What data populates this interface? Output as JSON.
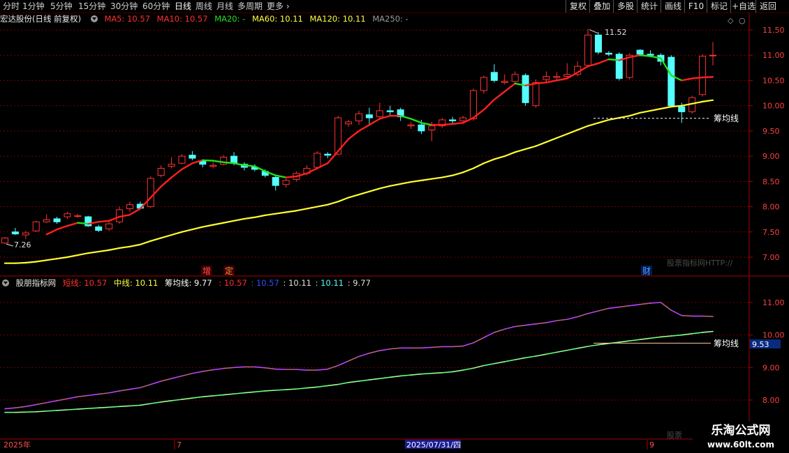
{
  "toolbar": {
    "periods": [
      "分时",
      "1分钟",
      "5分钟",
      "15分钟",
      "30分钟",
      "60分钟",
      "日线",
      "周线",
      "月线",
      "多周期",
      "更多"
    ],
    "active_period": "日线",
    "tools": [
      "复权",
      "叠加",
      "多股",
      "统计",
      "画线",
      "F10",
      "标记",
      "+自选",
      "返回"
    ]
  },
  "main_header": {
    "stock": "宏达股份(日线 前复权)",
    "ma5": "MA5: 10.57",
    "ma10": "MA10: 10.57",
    "ma20": "MA20: -",
    "ma60": "MA60: 10.11",
    "ma120": "MA120: 10.11",
    "ma250": "MA250: -"
  },
  "sub_header": {
    "name": "股朋指标网",
    "short": "短线: 10.57",
    "mid": "中线: 10.11",
    "chip": "筹均线: 9.77",
    "v1": ": 10.57",
    "v2": ": 10.57",
    "v3": ": 10.11",
    "v4": ": 10.11",
    "v5": ": 9.77"
  },
  "annotations": {
    "high_label": "11.52",
    "low_label": "7.26",
    "chip_label_main": "筹均线",
    "chip_label_sub": "筹均线",
    "chip_value_tag": "9.53",
    "event_zeng": "增",
    "event_ding": "定",
    "event_cai": "财",
    "watermark_main": "股票指标网HTTP://",
    "watermark_sub": "股票"
  },
  "time_axis": {
    "labels": [
      "2025年",
      "7",
      "2025/07/31/四",
      "9"
    ]
  },
  "price_axis": {
    "ticks": [
      "11.50",
      "11.00",
      "10.50",
      "10.00",
      "9.50",
      "9.00",
      "8.50",
      "8.00",
      "7.50",
      "7.00"
    ]
  },
  "indicator_axis": {
    "ticks": [
      "11.00",
      "10.00",
      "9.00",
      "8.00"
    ]
  },
  "site_watermark": {
    "name": "乐淘公式网",
    "url": "www.60lt.com"
  },
  "colors": {
    "up": "#ff3232",
    "down": "#54ffff",
    "ma5": "#ff2020",
    "ma20": "#20e020",
    "ma60": "#ffff30",
    "grid": "#780000"
  },
  "chart_data": {
    "type": "candlestick",
    "ylim": [
      6.8,
      11.75
    ],
    "candles": [
      {
        "o": 7.28,
        "h": 7.4,
        "l": 7.26,
        "c": 7.38
      },
      {
        "o": 7.5,
        "h": 7.58,
        "l": 7.44,
        "c": 7.46
      },
      {
        "o": 7.44,
        "h": 7.52,
        "l": 7.36,
        "c": 7.48
      },
      {
        "o": 7.52,
        "h": 7.72,
        "l": 7.5,
        "c": 7.7
      },
      {
        "o": 7.7,
        "h": 7.85,
        "l": 7.68,
        "c": 7.74
      },
      {
        "o": 7.76,
        "h": 7.8,
        "l": 7.66,
        "c": 7.7
      },
      {
        "o": 7.8,
        "h": 7.9,
        "l": 7.76,
        "c": 7.86
      },
      {
        "o": 7.82,
        "h": 7.86,
        "l": 7.78,
        "c": 7.82
      },
      {
        "o": 7.8,
        "h": 7.82,
        "l": 7.6,
        "c": 7.62
      },
      {
        "o": 7.6,
        "h": 7.64,
        "l": 7.5,
        "c": 7.53
      },
      {
        "o": 7.56,
        "h": 7.7,
        "l": 7.52,
        "c": 7.66
      },
      {
        "o": 7.7,
        "h": 8.0,
        "l": 7.66,
        "c": 7.94
      },
      {
        "o": 7.96,
        "h": 8.1,
        "l": 7.9,
        "c": 8.04
      },
      {
        "o": 8.05,
        "h": 8.1,
        "l": 7.96,
        "c": 7.97
      },
      {
        "o": 8.0,
        "h": 8.6,
        "l": 7.98,
        "c": 8.56
      },
      {
        "o": 8.62,
        "h": 8.82,
        "l": 8.58,
        "c": 8.76
      },
      {
        "o": 8.8,
        "h": 8.98,
        "l": 8.76,
        "c": 8.84
      },
      {
        "o": 8.86,
        "h": 9.04,
        "l": 8.84,
        "c": 9.0
      },
      {
        "o": 9.02,
        "h": 9.1,
        "l": 8.92,
        "c": 8.96
      },
      {
        "o": 8.9,
        "h": 8.94,
        "l": 8.78,
        "c": 8.84
      },
      {
        "o": 8.8,
        "h": 8.88,
        "l": 8.76,
        "c": 8.82
      },
      {
        "o": 8.84,
        "h": 9.02,
        "l": 8.82,
        "c": 8.98
      },
      {
        "o": 9.0,
        "h": 9.08,
        "l": 8.82,
        "c": 8.86
      },
      {
        "o": 8.84,
        "h": 8.88,
        "l": 8.72,
        "c": 8.78
      },
      {
        "o": 8.78,
        "h": 8.84,
        "l": 8.7,
        "c": 8.74
      },
      {
        "o": 8.7,
        "h": 8.74,
        "l": 8.58,
        "c": 8.62
      },
      {
        "o": 8.58,
        "h": 8.62,
        "l": 8.32,
        "c": 8.42
      },
      {
        "o": 8.44,
        "h": 8.58,
        "l": 8.38,
        "c": 8.52
      },
      {
        "o": 8.54,
        "h": 8.7,
        "l": 8.5,
        "c": 8.66
      },
      {
        "o": 8.66,
        "h": 8.82,
        "l": 8.62,
        "c": 8.76
      },
      {
        "o": 8.78,
        "h": 9.1,
        "l": 8.76,
        "c": 9.06
      },
      {
        "o": 9.04,
        "h": 9.08,
        "l": 8.96,
        "c": 9.02
      },
      {
        "o": 9.04,
        "h": 9.8,
        "l": 9.02,
        "c": 9.76
      },
      {
        "o": 9.64,
        "h": 9.72,
        "l": 9.58,
        "c": 9.68
      },
      {
        "o": 9.7,
        "h": 9.9,
        "l": 9.62,
        "c": 9.84
      },
      {
        "o": 9.82,
        "h": 9.96,
        "l": 9.6,
        "c": 9.76
      },
      {
        "o": 9.78,
        "h": 10.06,
        "l": 9.74,
        "c": 9.9
      },
      {
        "o": 9.9,
        "h": 10.0,
        "l": 9.8,
        "c": 9.88
      },
      {
        "o": 9.92,
        "h": 9.96,
        "l": 9.7,
        "c": 9.78
      },
      {
        "o": 9.6,
        "h": 9.68,
        "l": 9.54,
        "c": 9.62
      },
      {
        "o": 9.62,
        "h": 9.72,
        "l": 9.44,
        "c": 9.5
      },
      {
        "o": 9.52,
        "h": 9.68,
        "l": 9.3,
        "c": 9.6
      },
      {
        "o": 9.6,
        "h": 9.76,
        "l": 9.56,
        "c": 9.72
      },
      {
        "o": 9.72,
        "h": 9.78,
        "l": 9.64,
        "c": 9.7
      },
      {
        "o": 9.7,
        "h": 9.8,
        "l": 9.66,
        "c": 9.76
      },
      {
        "o": 9.74,
        "h": 10.34,
        "l": 9.7,
        "c": 10.3
      },
      {
        "o": 10.3,
        "h": 10.6,
        "l": 10.24,
        "c": 10.56
      },
      {
        "o": 10.66,
        "h": 10.82,
        "l": 10.46,
        "c": 10.5
      },
      {
        "o": 10.46,
        "h": 10.62,
        "l": 10.42,
        "c": 10.48
      },
      {
        "o": 10.48,
        "h": 10.68,
        "l": 10.44,
        "c": 10.62
      },
      {
        "o": 10.6,
        "h": 10.64,
        "l": 10.0,
        "c": 10.06
      },
      {
        "o": 10.0,
        "h": 10.52,
        "l": 9.96,
        "c": 10.46
      },
      {
        "o": 10.52,
        "h": 10.68,
        "l": 10.46,
        "c": 10.58
      },
      {
        "o": 10.56,
        "h": 10.66,
        "l": 10.5,
        "c": 10.58
      },
      {
        "o": 10.58,
        "h": 10.84,
        "l": 10.54,
        "c": 10.62
      },
      {
        "o": 10.62,
        "h": 10.88,
        "l": 10.58,
        "c": 10.78
      },
      {
        "o": 10.8,
        "h": 11.52,
        "l": 10.76,
        "c": 11.4
      },
      {
        "o": 11.4,
        "h": 11.46,
        "l": 11.02,
        "c": 11.06
      },
      {
        "o": 11.04,
        "h": 11.08,
        "l": 10.98,
        "c": 11.02
      },
      {
        "o": 11.02,
        "h": 11.06,
        "l": 10.5,
        "c": 10.54
      },
      {
        "o": 10.56,
        "h": 11.04,
        "l": 10.52,
        "c": 11.0
      },
      {
        "o": 11.1,
        "h": 11.12,
        "l": 10.98,
        "c": 11.02
      },
      {
        "o": 11.02,
        "h": 11.1,
        "l": 10.96,
        "c": 11.0
      },
      {
        "o": 11.0,
        "h": 11.04,
        "l": 10.8,
        "c": 10.88
      },
      {
        "o": 10.96,
        "h": 11.0,
        "l": 9.98,
        "c": 10.0
      },
      {
        "o": 9.98,
        "h": 10.06,
        "l": 9.66,
        "c": 9.88
      },
      {
        "o": 9.88,
        "h": 10.2,
        "l": 9.84,
        "c": 10.16
      },
      {
        "o": 10.22,
        "h": 11.02,
        "l": 10.18,
        "c": 10.98
      },
      {
        "o": 11.0,
        "h": 11.26,
        "l": 10.8,
        "c": 11.0
      }
    ],
    "ma5": [
      null,
      null,
      null,
      null,
      7.45,
      7.55,
      7.62,
      7.68,
      7.66,
      7.7,
      7.72,
      7.8,
      7.84,
      7.96,
      8.18,
      8.4,
      8.58,
      8.74,
      8.86,
      8.92,
      8.91,
      8.88,
      8.86,
      8.82,
      8.8,
      8.7,
      8.62,
      8.58,
      8.6,
      8.66,
      8.76,
      8.86,
      9.1,
      9.34,
      9.5,
      9.62,
      9.74,
      9.8,
      9.8,
      9.74,
      9.66,
      9.62,
      9.62,
      9.64,
      9.66,
      9.76,
      9.92,
      10.12,
      10.28,
      10.44,
      10.4,
      10.44,
      10.46,
      10.5,
      10.54,
      10.66,
      10.78,
      10.84,
      10.92,
      10.9,
      10.96,
      11.0,
      10.98,
      10.94,
      10.6,
      10.5,
      10.54,
      10.56,
      10.57
    ],
    "ma60": [
      6.88,
      6.88,
      6.89,
      6.91,
      6.94,
      6.97,
      7.0,
      7.04,
      7.08,
      7.11,
      7.14,
      7.18,
      7.21,
      7.25,
      7.32,
      7.38,
      7.44,
      7.5,
      7.55,
      7.6,
      7.64,
      7.68,
      7.72,
      7.76,
      7.79,
      7.83,
      7.86,
      7.89,
      7.92,
      7.96,
      8.0,
      8.04,
      8.1,
      8.18,
      8.24,
      8.3,
      8.36,
      8.41,
      8.45,
      8.49,
      8.52,
      8.55,
      8.58,
      8.62,
      8.68,
      8.76,
      8.86,
      8.94,
      9.0,
      9.08,
      9.14,
      9.2,
      9.28,
      9.36,
      9.44,
      9.52,
      9.6,
      9.66,
      9.72,
      9.76,
      9.8,
      9.86,
      9.9,
      9.94,
      9.98,
      10.0,
      10.04,
      10.08,
      10.11
    ],
    "chip_line": 9.77,
    "indicator": {
      "ylim": [
        7.5,
        11.9
      ],
      "short": [
        7.73,
        7.76,
        7.8,
        7.86,
        7.92,
        7.98,
        8.04,
        8.1,
        8.14,
        8.18,
        8.22,
        8.28,
        8.33,
        8.38,
        8.48,
        8.58,
        8.66,
        8.74,
        8.82,
        8.88,
        8.93,
        8.97,
        9.0,
        9.02,
        9.02,
        8.99,
        8.95,
        8.94,
        8.94,
        8.92,
        8.92,
        8.95,
        9.06,
        9.2,
        9.34,
        9.44,
        9.52,
        9.57,
        9.6,
        9.6,
        9.6,
        9.62,
        9.64,
        9.64,
        9.66,
        9.76,
        9.92,
        10.08,
        10.18,
        10.26,
        10.3,
        10.34,
        10.38,
        10.44,
        10.48,
        10.56,
        10.66,
        10.74,
        10.82,
        10.86,
        10.9,
        10.94,
        10.98,
        11.0,
        10.76,
        10.6,
        10.58,
        10.58,
        10.57
      ],
      "mid": [
        7.62,
        7.62,
        7.63,
        7.64,
        7.66,
        7.68,
        7.7,
        7.72,
        7.74,
        7.76,
        7.78,
        7.8,
        7.82,
        7.84,
        7.89,
        7.94,
        7.98,
        8.02,
        8.06,
        8.1,
        8.13,
        8.16,
        8.19,
        8.22,
        8.25,
        8.28,
        8.3,
        8.32,
        8.34,
        8.37,
        8.4,
        8.44,
        8.48,
        8.54,
        8.58,
        8.62,
        8.66,
        8.7,
        8.74,
        8.77,
        8.8,
        8.82,
        8.84,
        8.87,
        8.92,
        8.98,
        9.06,
        9.12,
        9.18,
        9.24,
        9.3,
        9.35,
        9.41,
        9.47,
        9.53,
        9.59,
        9.65,
        9.7,
        9.74,
        9.78,
        9.82,
        9.86,
        9.9,
        9.94,
        9.97,
        10.0,
        10.04,
        10.08,
        10.11
      ]
    }
  }
}
